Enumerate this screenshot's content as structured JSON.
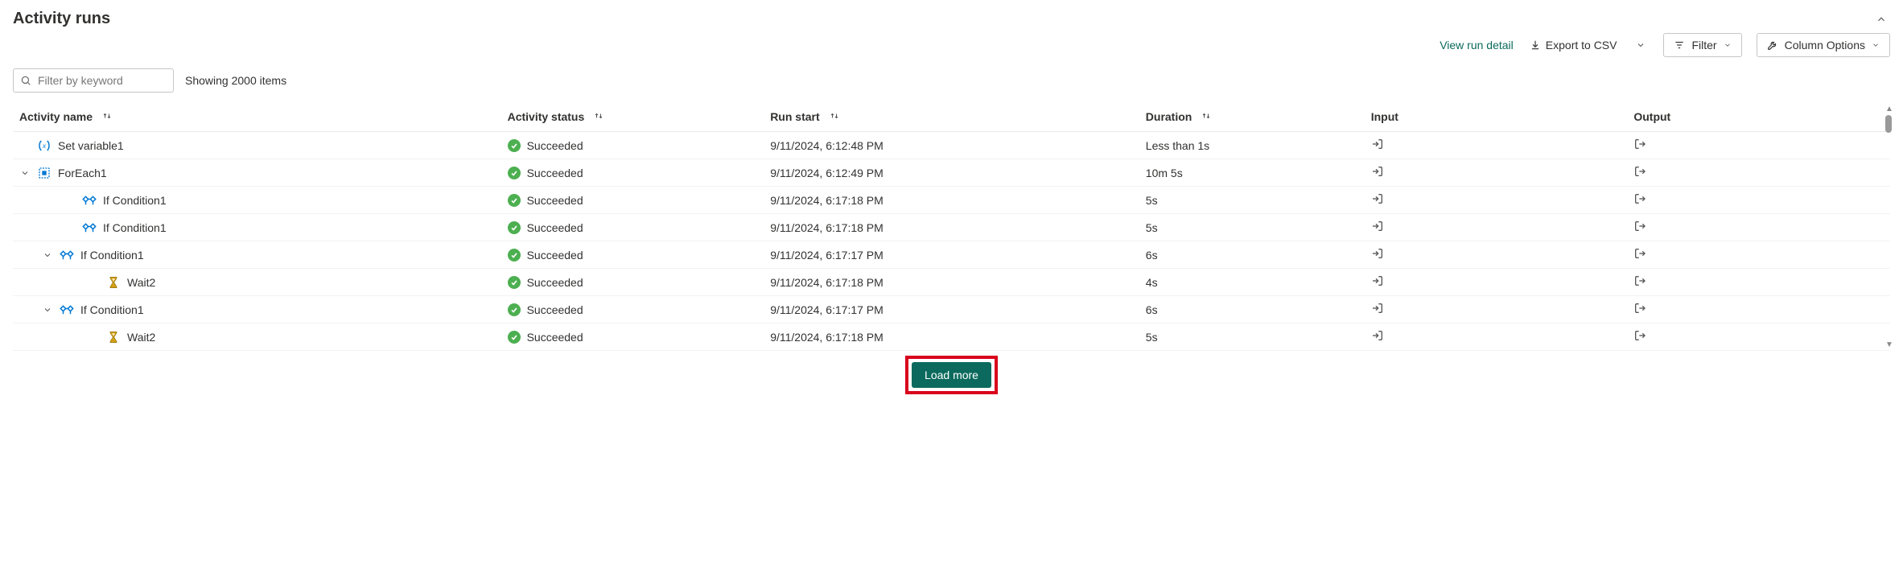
{
  "title": "Activity runs",
  "toolbar": {
    "view_detail": "View run detail",
    "export_csv": "Export to CSV",
    "filter": "Filter",
    "columns": "Column Options"
  },
  "search": {
    "placeholder": "Filter by keyword"
  },
  "item_count": "Showing 2000 items",
  "columns": {
    "name": "Activity name",
    "status": "Activity status",
    "start": "Run start",
    "duration": "Duration",
    "input": "Input",
    "output": "Output"
  },
  "rows": [
    {
      "indent": 0,
      "expander": "",
      "icon": "variable",
      "name": "Set variable1",
      "status": "Succeeded",
      "start": "9/11/2024, 6:12:48 PM",
      "duration": "Less than 1s"
    },
    {
      "indent": 0,
      "expander": "down",
      "icon": "foreach",
      "name": "ForEach1",
      "status": "Succeeded",
      "start": "9/11/2024, 6:12:49 PM",
      "duration": "10m 5s"
    },
    {
      "indent": 2,
      "expander": "",
      "icon": "ifcond",
      "name": "If Condition1",
      "status": "Succeeded",
      "start": "9/11/2024, 6:17:18 PM",
      "duration": "5s"
    },
    {
      "indent": 2,
      "expander": "",
      "icon": "ifcond",
      "name": "If Condition1",
      "status": "Succeeded",
      "start": "9/11/2024, 6:17:18 PM",
      "duration": "5s"
    },
    {
      "indent": 1,
      "expander": "down",
      "icon": "ifcond",
      "name": "If Condition1",
      "status": "Succeeded",
      "start": "9/11/2024, 6:17:17 PM",
      "duration": "6s"
    },
    {
      "indent": 3,
      "expander": "",
      "icon": "wait",
      "name": "Wait2",
      "status": "Succeeded",
      "start": "9/11/2024, 6:17:18 PM",
      "duration": "4s"
    },
    {
      "indent": 1,
      "expander": "down",
      "icon": "ifcond",
      "name": "If Condition1",
      "status": "Succeeded",
      "start": "9/11/2024, 6:17:17 PM",
      "duration": "6s"
    },
    {
      "indent": 3,
      "expander": "",
      "icon": "wait",
      "name": "Wait2",
      "status": "Succeeded",
      "start": "9/11/2024, 6:17:18 PM",
      "duration": "5s"
    }
  ],
  "load_more": "Load more"
}
